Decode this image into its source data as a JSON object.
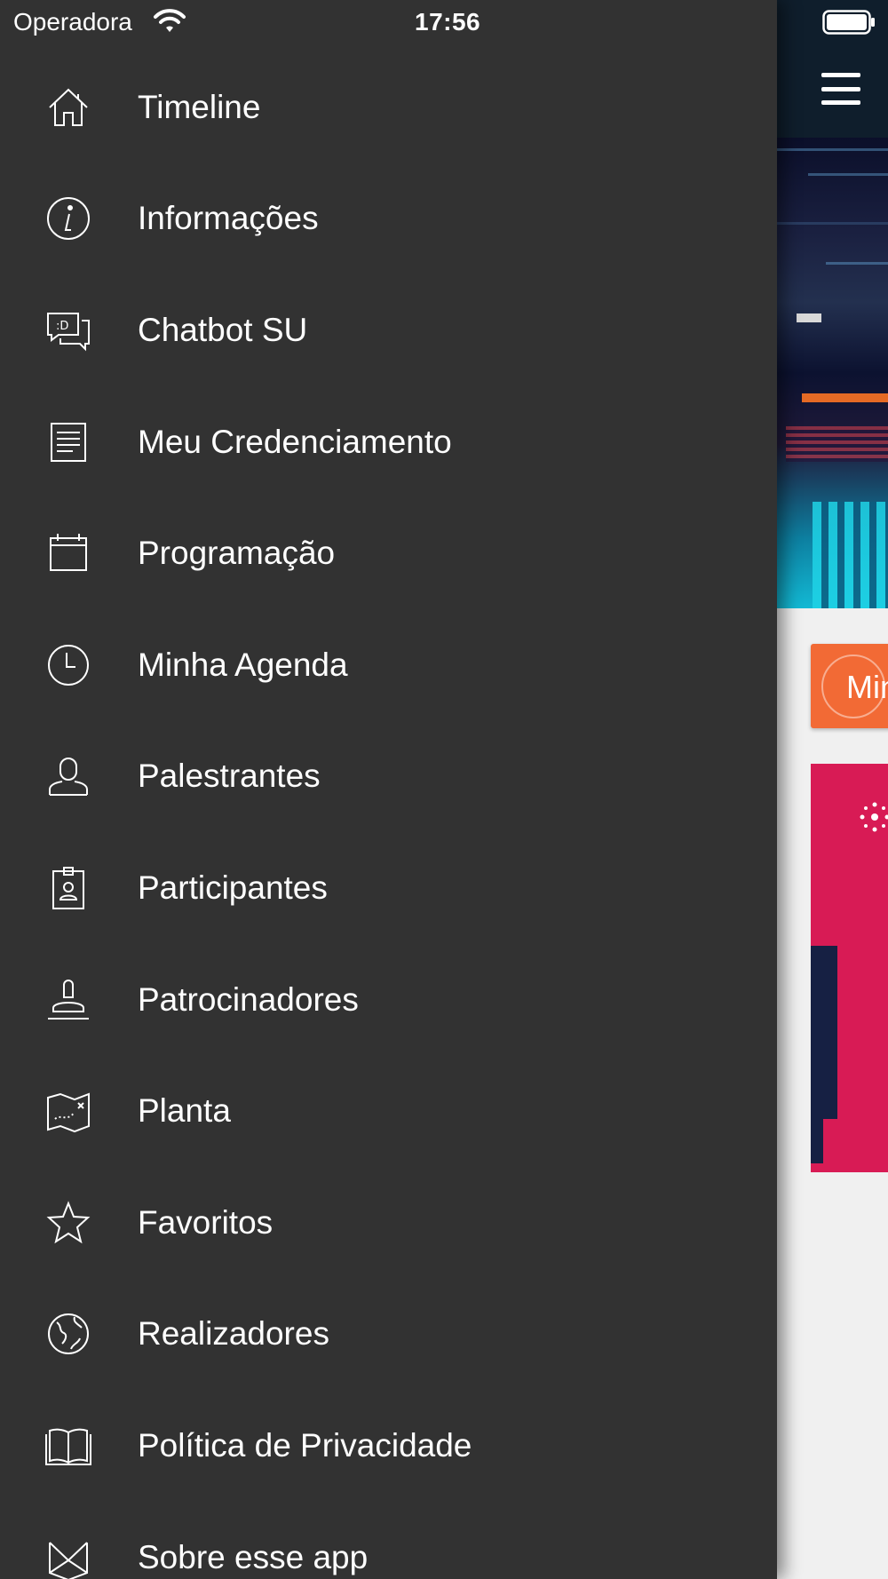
{
  "status_bar": {
    "carrier": "Operadora",
    "time": "17:56"
  },
  "drawer": {
    "items": [
      {
        "label": "Timeline",
        "icon": "home-icon"
      },
      {
        "label": "Informações",
        "icon": "info-icon"
      },
      {
        "label": "Chatbot SU",
        "icon": "chat-icon"
      },
      {
        "label": "Meu Credenciamento",
        "icon": "document-icon"
      },
      {
        "label": "Programação",
        "icon": "calendar-icon"
      },
      {
        "label": "Minha Agenda",
        "icon": "clock-icon"
      },
      {
        "label": "Palestrantes",
        "icon": "person-icon"
      },
      {
        "label": "Participantes",
        "icon": "badge-icon"
      },
      {
        "label": "Patrocinadores",
        "icon": "stamp-icon"
      },
      {
        "label": "Planta",
        "icon": "map-icon"
      },
      {
        "label": "Favoritos",
        "icon": "star-icon"
      },
      {
        "label": "Realizadores",
        "icon": "globe-icon"
      },
      {
        "label": "Política de Privacidade",
        "icon": "book-icon"
      },
      {
        "label": "Sobre esse app",
        "icon": "envelope-icon"
      }
    ]
  },
  "background": {
    "agenda_button_label": "Min"
  },
  "colors": {
    "drawer_bg": "#323232",
    "header_bg": "#0f1e2c",
    "agenda_orange": "#f26a35",
    "promo_pink": "#d81b55"
  }
}
